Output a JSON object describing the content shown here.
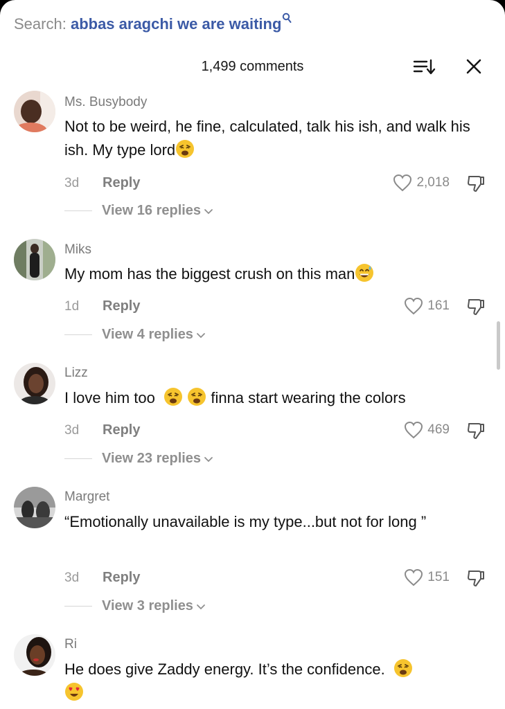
{
  "search": {
    "prefix": "Search:",
    "query": "abbas aragchi we are waiting"
  },
  "header": {
    "comment_count": "1,499 comments"
  },
  "icons": {
    "sort": "sort-icon",
    "close": "close-icon",
    "heart": "heart-icon",
    "dislike": "thumbs-down-icon",
    "chevron": "chevron-down-icon"
  },
  "comments": [
    {
      "name": "Ms. Busybody",
      "text": "Not to be weird, he fine, calculated, talk his ish, and walk his ish. My type lord",
      "emoji": [
        "weary-face"
      ],
      "age": "3d",
      "reply": "Reply",
      "likes": "2,018",
      "view_replies": "View 16 replies"
    },
    {
      "name": "Miks",
      "text": "My mom has the biggest crush on this man",
      "emoji": [
        "grinning-sweat-face"
      ],
      "age": "1d",
      "reply": "Reply",
      "likes": "161",
      "view_replies": "View 4 replies"
    },
    {
      "name": "Lizz",
      "text_before": "I love him too",
      "text_after": "finna start wearing the colors",
      "emoji": [
        "weary-face",
        "weary-face"
      ],
      "age": "3d",
      "reply": "Reply",
      "likes": "469",
      "view_replies": "View 23 replies"
    },
    {
      "name": "Margret",
      "text": "“Emotionally unavailable is my type...but not for long ”",
      "age": "3d",
      "reply": "Reply",
      "likes": "151",
      "view_replies": "View 3 replies"
    },
    {
      "name": "Ri",
      "text": "He does give Zaddy energy. It’s the confidence.",
      "emoji": [
        "weary-face",
        "heart-eyes-face"
      ]
    }
  ]
}
